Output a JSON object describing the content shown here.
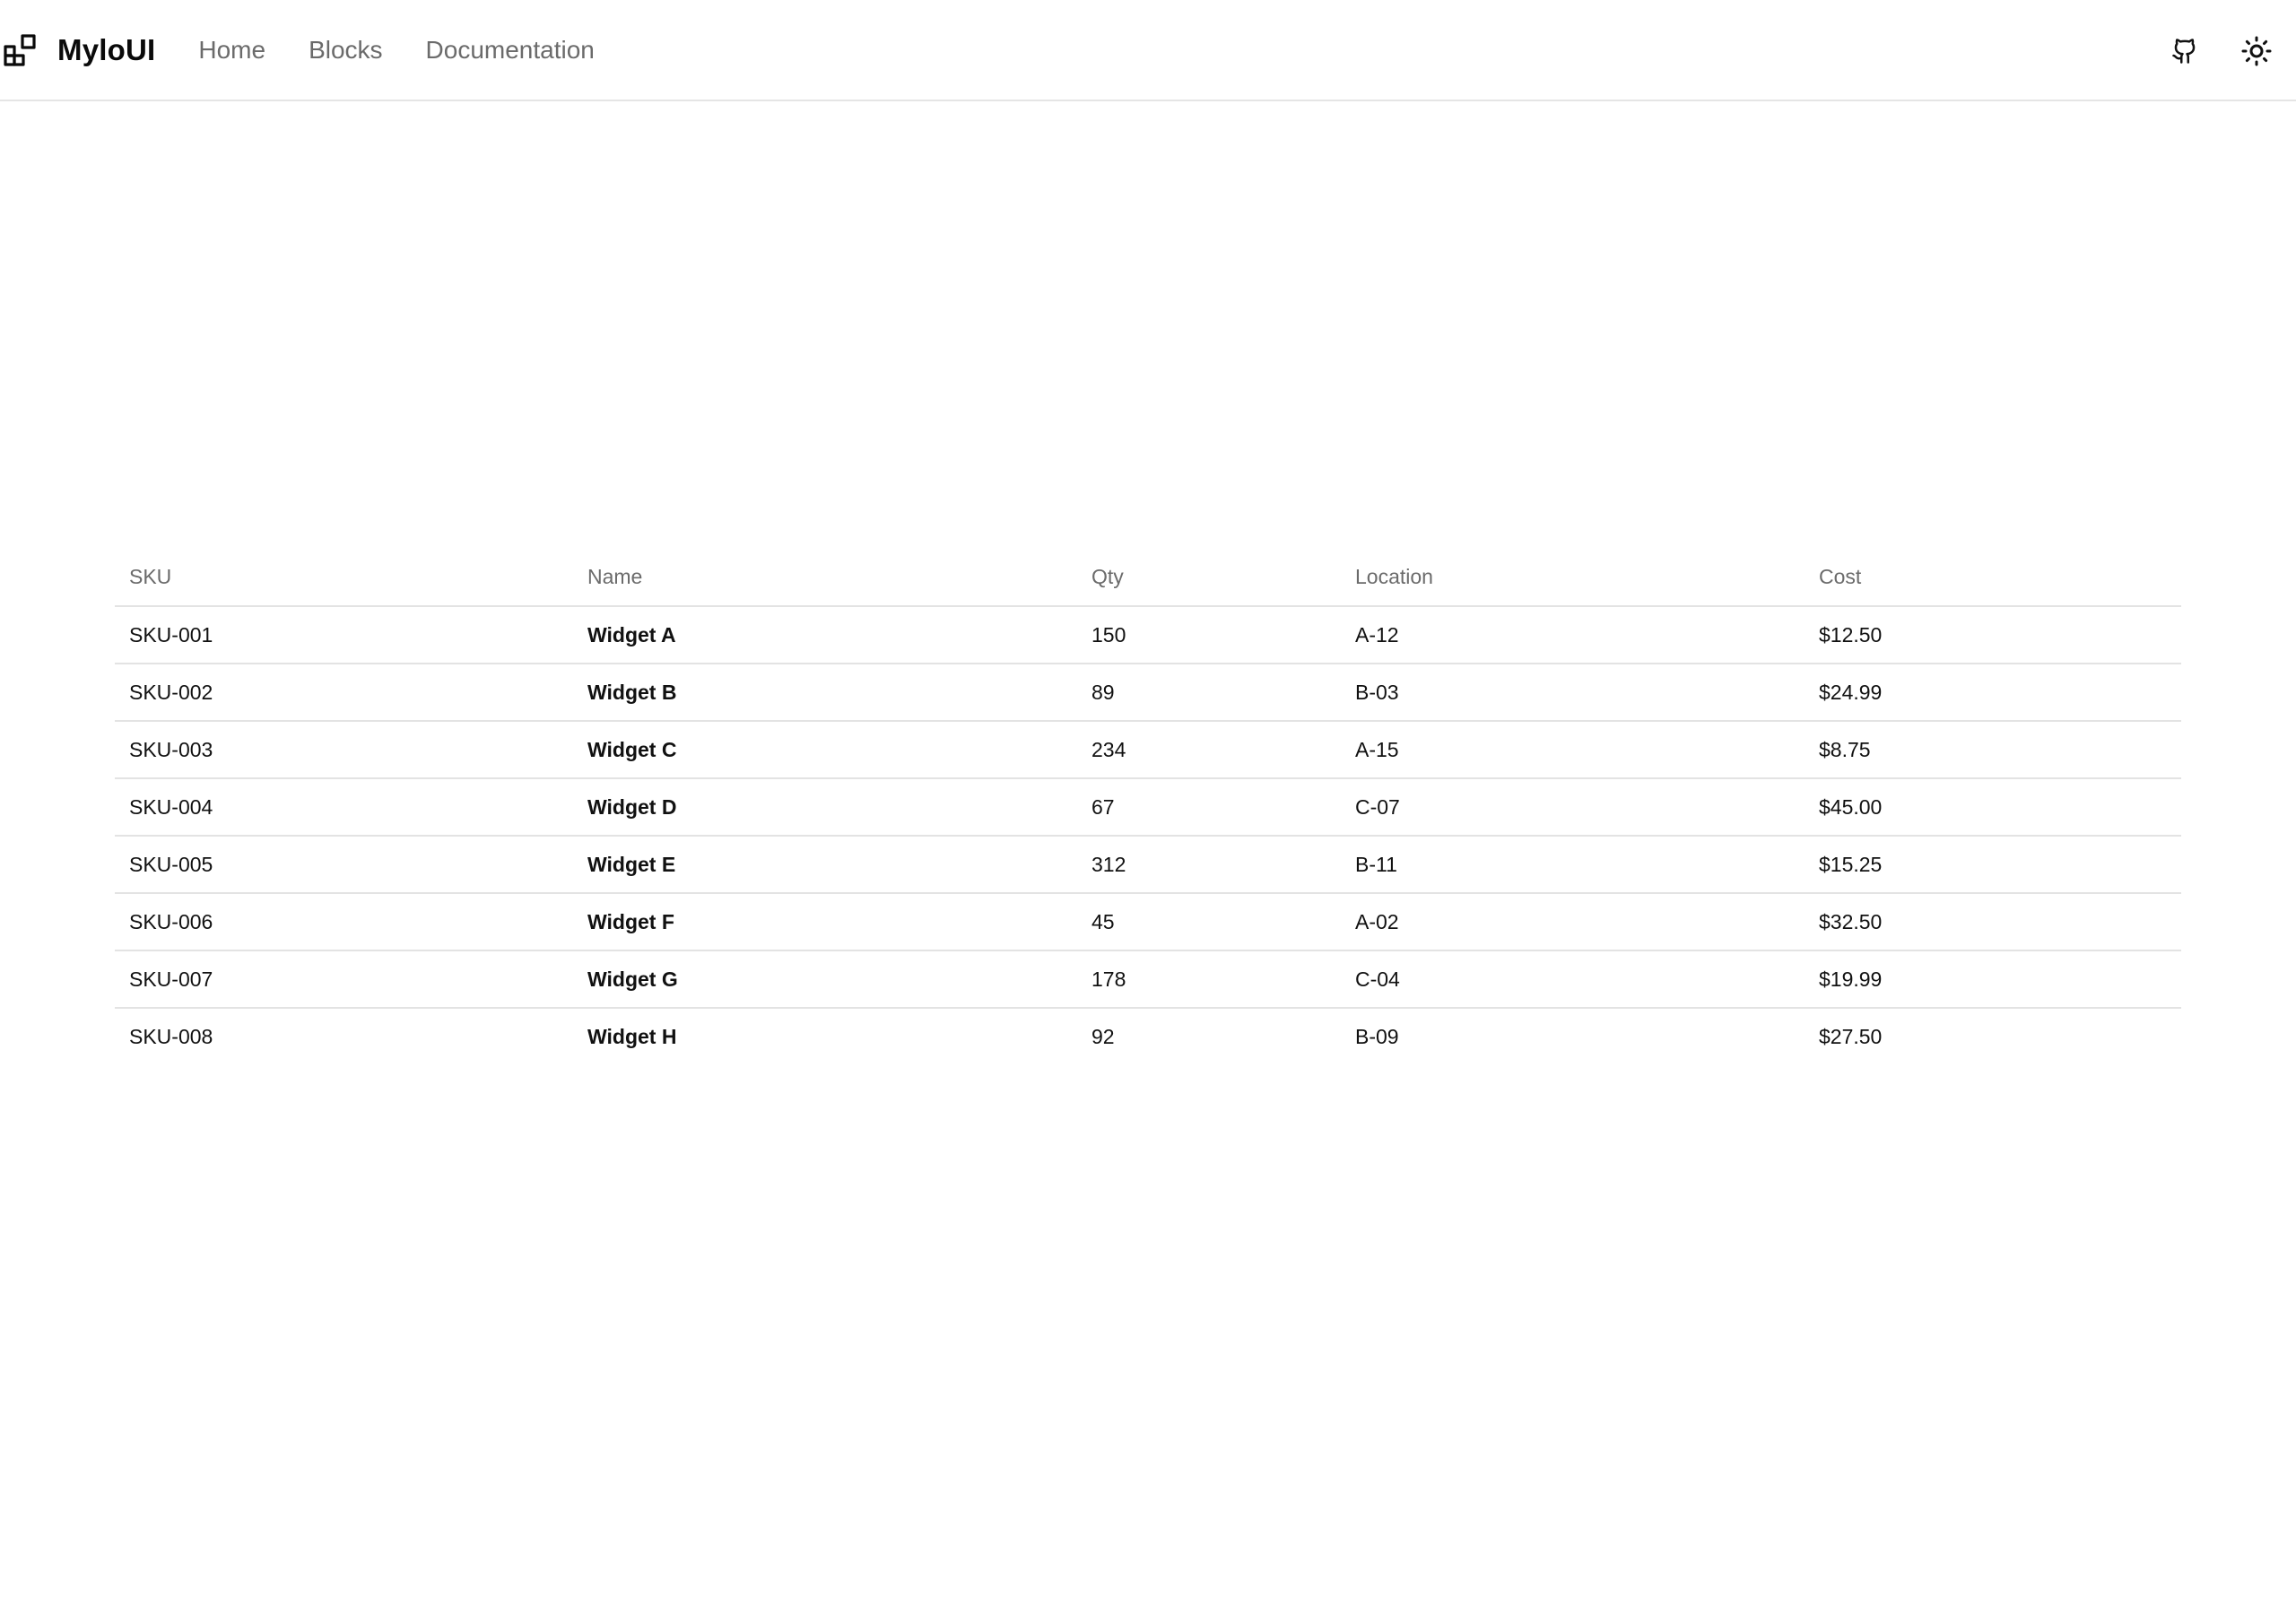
{
  "header": {
    "brand_name": "MyloUI",
    "brand_icon": "blocks-logo-icon",
    "nav": [
      {
        "label": "Home"
      },
      {
        "label": "Blocks"
      },
      {
        "label": "Documentation"
      }
    ],
    "actions": {
      "github_icon": "github-icon",
      "theme_icon": "sun-icon"
    }
  },
  "table": {
    "columns": [
      "SKU",
      "Name",
      "Qty",
      "Location",
      "Cost"
    ],
    "rows": [
      [
        "SKU-001",
        "Widget A",
        "150",
        "A-12",
        "$12.50"
      ],
      [
        "SKU-002",
        "Widget B",
        "89",
        "B-03",
        "$24.99"
      ],
      [
        "SKU-003",
        "Widget C",
        "234",
        "A-15",
        "$8.75"
      ],
      [
        "SKU-004",
        "Widget D",
        "67",
        "C-07",
        "$45.00"
      ],
      [
        "SKU-005",
        "Widget E",
        "312",
        "B-11",
        "$15.25"
      ],
      [
        "SKU-006",
        "Widget F",
        "45",
        "A-02",
        "$32.50"
      ],
      [
        "SKU-007",
        "Widget G",
        "178",
        "C-04",
        "$19.99"
      ],
      [
        "SKU-008",
        "Widget H",
        "92",
        "B-09",
        "$27.50"
      ]
    ]
  },
  "colors": {
    "text": "#111111",
    "muted": "#6b6b6b",
    "border": "#e3e3e3",
    "background": "#ffffff"
  }
}
